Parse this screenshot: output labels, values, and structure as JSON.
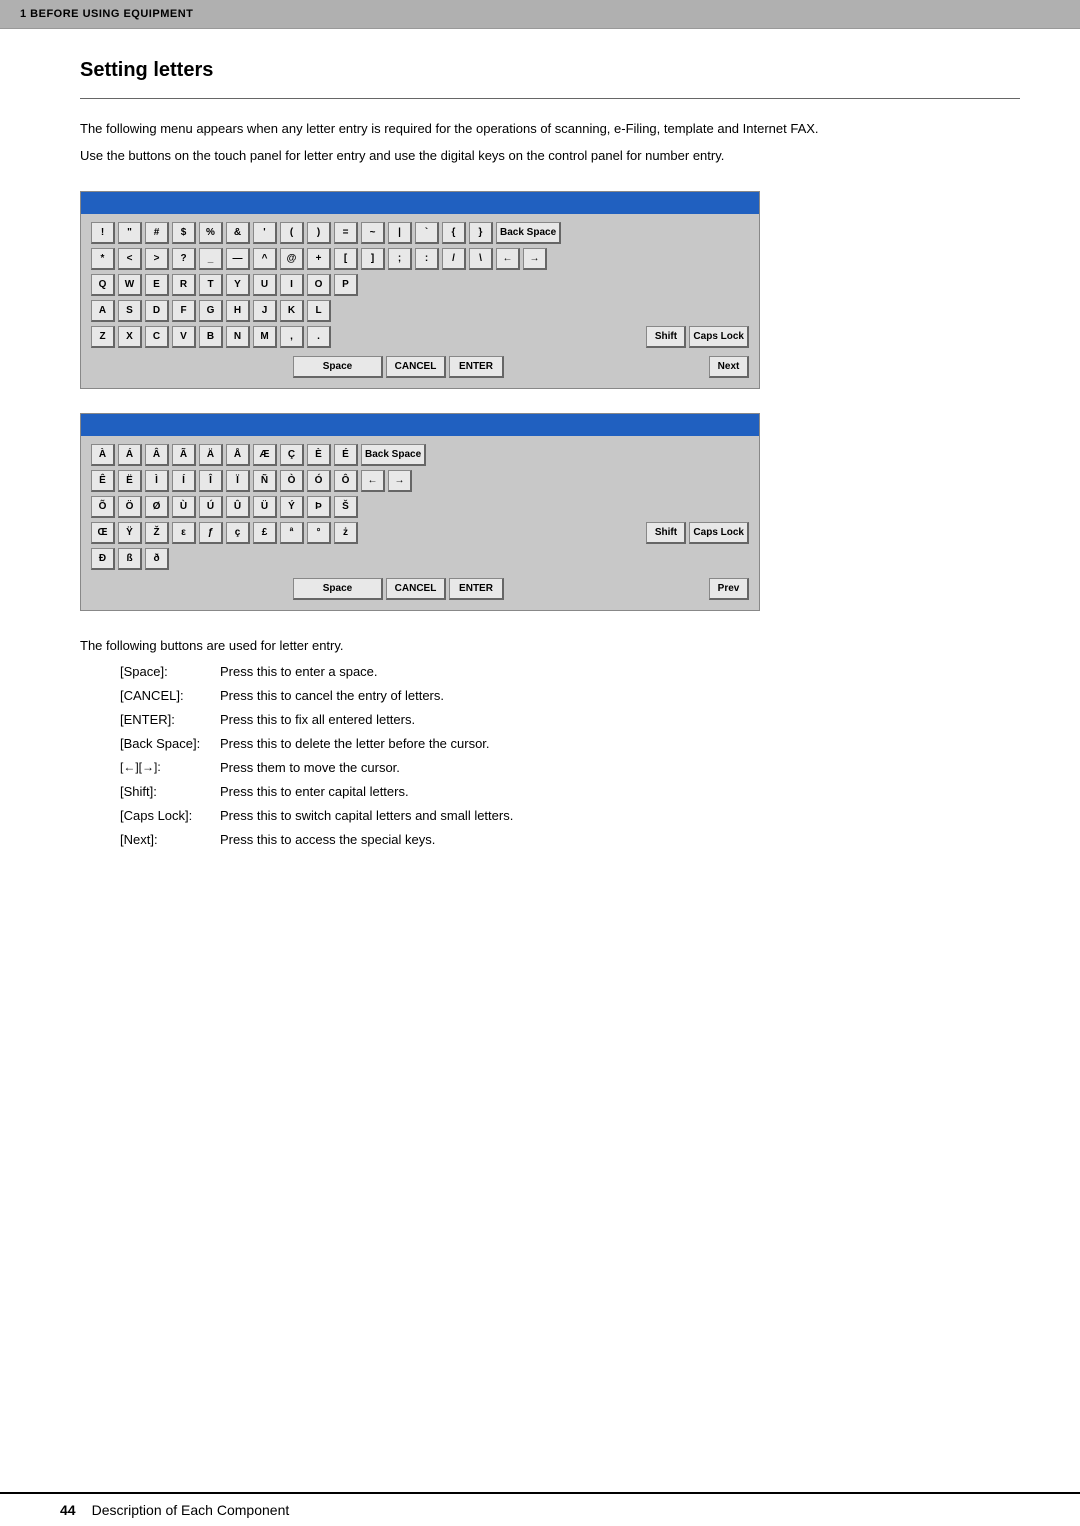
{
  "header": {
    "label": "1  BEFORE USING EQUIPMENT"
  },
  "page_title": "Setting letters",
  "intro_paragraph1": "The following menu appears when any letter entry is required for the operations of scanning, e-Filing, template and Internet FAX.",
  "intro_paragraph2": "Use the buttons on the touch panel for letter entry and use the digital keys on the control panel for number entry.",
  "keyboard1": {
    "row1": [
      "!",
      "\"",
      "#",
      "$",
      "%",
      "&",
      "'",
      "(",
      ")",
      "=",
      "~",
      "|",
      "`",
      "{",
      "}"
    ],
    "row2": [
      "*",
      "<",
      ">",
      "?",
      "_",
      "—",
      "^",
      "@",
      "+",
      "[",
      "]",
      ";",
      ":",
      "/",
      "\\"
    ],
    "row3": [
      "Q",
      "W",
      "E",
      "R",
      "T",
      "Y",
      "U",
      "I",
      "O",
      "P"
    ],
    "row4": [
      "A",
      "S",
      "D",
      "F",
      "G",
      "H",
      "J",
      "K",
      "L"
    ],
    "row5": [
      "Z",
      "X",
      "C",
      "V",
      "B",
      "N",
      "M",
      ",",
      "."
    ],
    "right_keys": [
      "Back Space",
      "←",
      "→"
    ],
    "shift_label": "Shift",
    "capslock_label": "Caps Lock",
    "space_label": "Space",
    "cancel_label": "CANCEL",
    "enter_label": "ENTER",
    "next_label": "Next"
  },
  "keyboard2": {
    "row1": [
      "À",
      "Á",
      "Â",
      "Ã",
      "Ä",
      "Å",
      "Æ",
      "Ç",
      "È",
      "É"
    ],
    "row2": [
      "Ê",
      "Ë",
      "Ì",
      "Í",
      "Î",
      "Ï",
      "Ñ",
      "Ò",
      "Ó",
      "Ô"
    ],
    "row3": [
      "Õ",
      "Ö",
      "Ø",
      "Ù",
      "Ú",
      "Û",
      "Ü",
      "Ý",
      "Þ",
      "Š"
    ],
    "row4": [
      "Œ",
      "Ÿ",
      "Ž",
      "ε",
      "ƒ",
      "ç",
      "£",
      "ª",
      "°",
      "ż"
    ],
    "row5": [
      "Ð",
      "ß",
      "ð"
    ],
    "right_keys": [
      "Back Space",
      "←",
      "→"
    ],
    "shift_label": "Shift",
    "capslock_label": "Caps Lock",
    "space_label": "Space",
    "cancel_label": "CANCEL",
    "enter_label": "ENTER",
    "prev_label": "Prev"
  },
  "description": {
    "intro": "The following buttons are used for letter entry.",
    "items": [
      {
        "label": "[Space]:",
        "text": "Press this to enter a space."
      },
      {
        "label": "[CANCEL]:",
        "text": "Press this to cancel the entry of letters."
      },
      {
        "label": "[ENTER]:",
        "text": "Press this to fix all entered letters."
      },
      {
        "label": "[Back Space]:",
        "text": "Press this to delete the letter before the cursor."
      },
      {
        "label": "[←][→]:",
        "text": "Press them to move the cursor."
      },
      {
        "label": "[Shift]:",
        "text": "Press this to enter capital letters."
      },
      {
        "label": "[Caps Lock]:",
        "text": "Press this to switch capital letters and small letters."
      },
      {
        "label": "[Next]:",
        "text": "Press this to access the special keys."
      }
    ]
  },
  "footer": {
    "page_number": "44",
    "text": "Description of Each Component"
  }
}
